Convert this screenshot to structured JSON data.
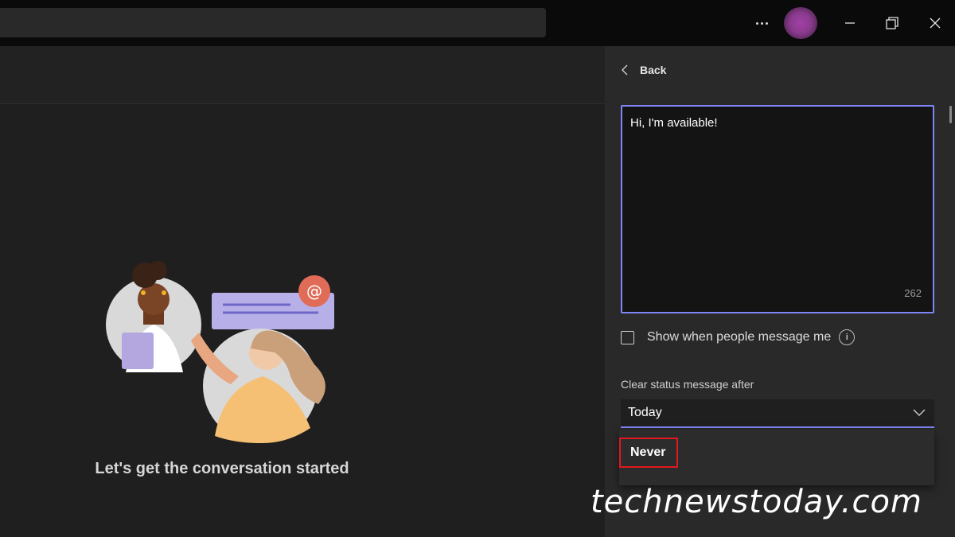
{
  "titlebar": {
    "more_label": "More options",
    "icons": [
      "more-icon",
      "minimize-icon",
      "maximize-icon",
      "close-icon"
    ]
  },
  "main": {
    "empty_state_text": "Let's get the conversation started"
  },
  "status_panel": {
    "back_label": "Back",
    "message_text": "Hi, I'm available!",
    "char_count": "262",
    "show_when_message_label": "Show when people message me",
    "show_when_message_checked": false,
    "clear_after_label": "Clear status message after",
    "clear_after_value": "Today",
    "options": [
      "Never"
    ]
  },
  "watermark": "technewstoday.com",
  "colors": {
    "accent": "#7f85f5",
    "highlight_border": "#e0191e",
    "panel_bg": "#292929",
    "app_bg": "#1f1f1f"
  }
}
